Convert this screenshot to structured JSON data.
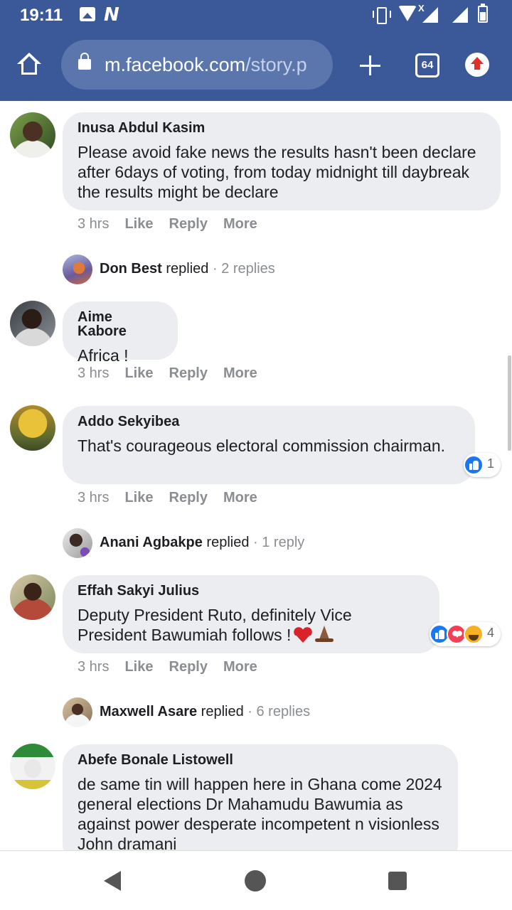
{
  "status_bar": {
    "time": "19:11",
    "icons": [
      "gallery-icon",
      "n-logo-icon",
      "vibrate-icon",
      "wifi-icon",
      "signal-icon",
      "signal-icon",
      "battery-icon"
    ],
    "network_badge": "X"
  },
  "browser": {
    "url_host": "m.facebook.com",
    "url_path": "/story.p",
    "tab_count": "64",
    "toolbar_color": "#3b5998"
  },
  "comments": [
    {
      "author": "Inusa Abdul Kasim",
      "text": "Please avoid fake news the results hasn't been declare after 6days of voting, from today midnight till daybreak the results might be declare",
      "time": "3 hrs",
      "actions": [
        "Like",
        "Reply",
        "More"
      ],
      "replies": {
        "name": "Don Best",
        "verb": "replied",
        "count": "· 2 replies"
      }
    },
    {
      "author": "Aime Kabore",
      "text": "Africa !",
      "time": "3 hrs",
      "actions": [
        "Like",
        "Reply",
        "More"
      ]
    },
    {
      "author": "Addo Sekyibea",
      "text": "That's courageous electoral commission chairman.",
      "time": "3 hrs",
      "actions": [
        "Like",
        "Reply",
        "More"
      ],
      "reactions": {
        "icons": [
          "like-reaction-icon"
        ],
        "count": "1"
      },
      "replies": {
        "name": "Anani Agbakpe",
        "verb": "replied",
        "count": "· 1 reply"
      }
    },
    {
      "author": "Effah Sakyi Julius",
      "text_line1": "Deputy President Ruto, definitely Vice",
      "text_line2": "President Bawumiah follows !",
      "emojis": [
        "heart-emoji",
        "folded-hands-emoji"
      ],
      "time": "3 hrs",
      "actions": [
        "Like",
        "Reply",
        "More"
      ],
      "reactions": {
        "icons": [
          "like-reaction-icon",
          "love-reaction-icon",
          "haha-reaction-icon"
        ],
        "count": "4"
      },
      "replies": {
        "name": "Maxwell Asare",
        "verb": "replied",
        "count": "· 6 replies"
      }
    },
    {
      "author": "Abefe Bonale Listowell",
      "text": "de same tin will happen here in Ghana come 2024 general elections Dr Mahamudu Bawumia as against power desperate incompetent n visionless John dramani"
    }
  ],
  "colors": {
    "bubble": "#ebedf0",
    "meta_text": "#8a8d91",
    "like_blue": "#1877f2",
    "love_red": "#f33e58",
    "haha_yellow": "#f7b125"
  }
}
